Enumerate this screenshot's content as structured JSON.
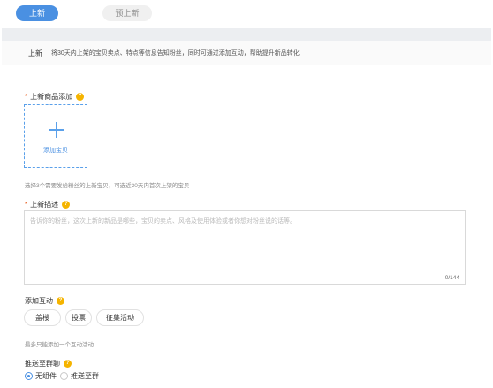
{
  "tabs": [
    {
      "label": "上新",
      "active": true
    },
    {
      "label": "预上新",
      "active": false
    }
  ],
  "info": {
    "title": "上新",
    "text": "将30天内上架的宝贝卖点、特点等信息告知粉丝，同时可通过添加互动，帮助提升新品转化"
  },
  "product_section": {
    "required_mark": "*",
    "label": "上新商品添加",
    "upload_label": "添加宝贝",
    "hint": "选择3个需要发给粉丝的上新宝贝，可选近30天内首次上架的宝贝"
  },
  "description_section": {
    "required_mark": "*",
    "label": "上新描述",
    "placeholder": "告诉你的粉丝，这次上新的新品是哪些，宝贝的卖点、风格及使用体验或者你想对粉丝说的话等。",
    "value": "",
    "char_count": "0/144"
  },
  "interaction_section": {
    "label": "添加互动",
    "options": [
      "盖楼",
      "投票",
      "征集活动"
    ],
    "hint": "最多只能添加一个互动活动"
  },
  "push_section": {
    "label": "推送至群聊",
    "options": [
      {
        "label": "无组件",
        "checked": true
      },
      {
        "label": "推送至群",
        "checked": false
      }
    ]
  },
  "colors": {
    "accent": "#4a90e2",
    "required": "#e85d1e",
    "help_icon": "#f5b400"
  },
  "icons": {
    "help": "question-circle-icon",
    "plus": "plus-icon"
  }
}
